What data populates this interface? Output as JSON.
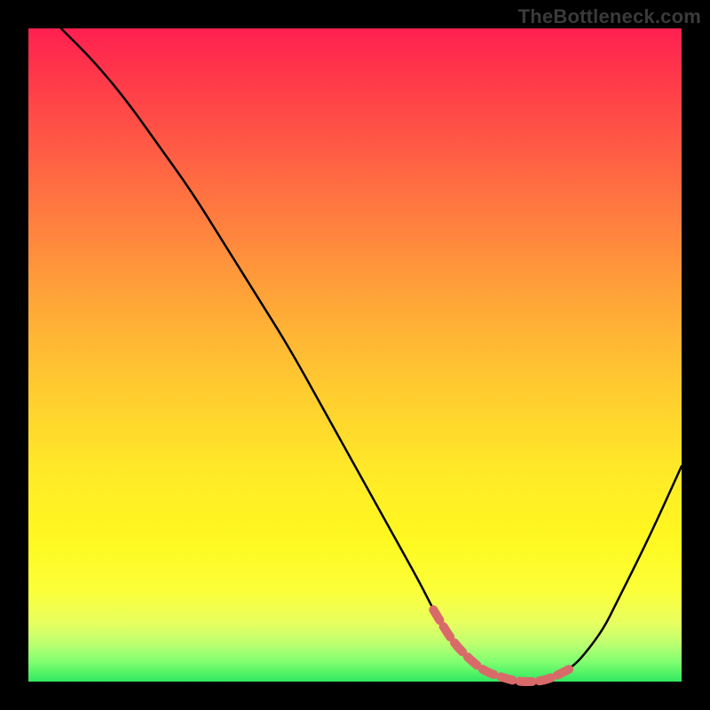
{
  "watermark": "TheBottleneck.com",
  "chart_data": {
    "type": "line",
    "title": "",
    "xlabel": "",
    "ylabel": "",
    "xlim": [
      0,
      100
    ],
    "ylim": [
      0,
      100
    ],
    "grid": false,
    "series": [
      {
        "name": "bottleneck-curve",
        "color": "#000000",
        "x": [
          5,
          10,
          15,
          20,
          25,
          30,
          35,
          40,
          45,
          50,
          55,
          60,
          62,
          65,
          68,
          70,
          73,
          75,
          78,
          80,
          83,
          85,
          88,
          90,
          95,
          100
        ],
        "y": [
          100,
          95,
          89,
          82,
          75,
          67,
          59,
          51,
          42,
          33,
          24,
          15,
          11,
          6,
          3,
          1.5,
          0.5,
          0,
          0,
          0.5,
          2,
          4,
          8,
          12,
          22,
          33
        ]
      },
      {
        "name": "optimal-range-highlight",
        "color": "#e06060",
        "x": [
          62,
          65,
          68,
          70,
          73,
          75,
          78,
          80,
          83
        ],
        "y": [
          11,
          6,
          3,
          1.5,
          0.5,
          0,
          0,
          0.5,
          2
        ]
      }
    ],
    "gradient_background": {
      "top": "#ff2050",
      "mid": "#ffd22e",
      "bottom": "#30e860"
    }
  }
}
